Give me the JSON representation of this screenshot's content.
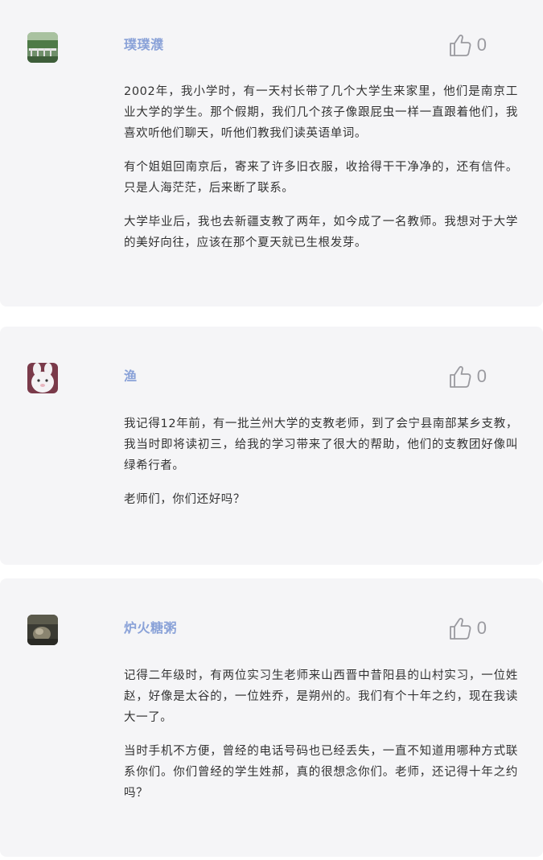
{
  "comments": [
    {
      "username": "璞璞濮",
      "avatar_icon": "landscape-photo-avatar",
      "like_count": "0",
      "paragraphs": [
        "2002年，我小学时，有一天村长带了几个大学生来家里，他们是南京工业大学的学生。那个假期，我们几个孩子像跟屁虫一样一直跟着他们，我喜欢听他们聊天，听他们教我们读英语单词。",
        "有个姐姐回南京后，寄来了许多旧衣服，收拾得干干净净的，还有信件。只是人海茫茫，后来断了联系。",
        "大学毕业后，我也去新疆支教了两年，如今成了一名教师。我想对于大学的美好向往，应该在那个夏天就已生根发芽。"
      ]
    },
    {
      "username": "渔",
      "avatar_icon": "white-rabbit-avatar",
      "like_count": "0",
      "paragraphs": [
        "我记得12年前，有一批兰州大学的支教老师，到了会宁县南部某乡支教，我当时即将读初三，给我的学习带来了很大的帮助，他们的支教团好像叫绿希行者。",
        "老师们，你们还好吗？"
      ]
    },
    {
      "username": "炉火糖粥",
      "avatar_icon": "dark-photo-avatar",
      "like_count": "0",
      "paragraphs": [
        "记得二年级时，有两位实习生老师来山西晋中昔阳县的山村实习，一位姓赵，好像是太谷的，一位姓乔，是朔州的。我们有个十年之约，现在我读大一了。",
        "当时手机不方便，曾经的电话号码也已经丢失，一直不知道用哪种方式联系你们。你们曾经的学生姓郝，真的很想念你们。老师，还记得十年之约吗？"
      ]
    }
  ],
  "colors": {
    "card_bg": "#f5f5f7",
    "username": "#8aa2d8",
    "text": "#333333",
    "like": "#9a9aa0"
  }
}
